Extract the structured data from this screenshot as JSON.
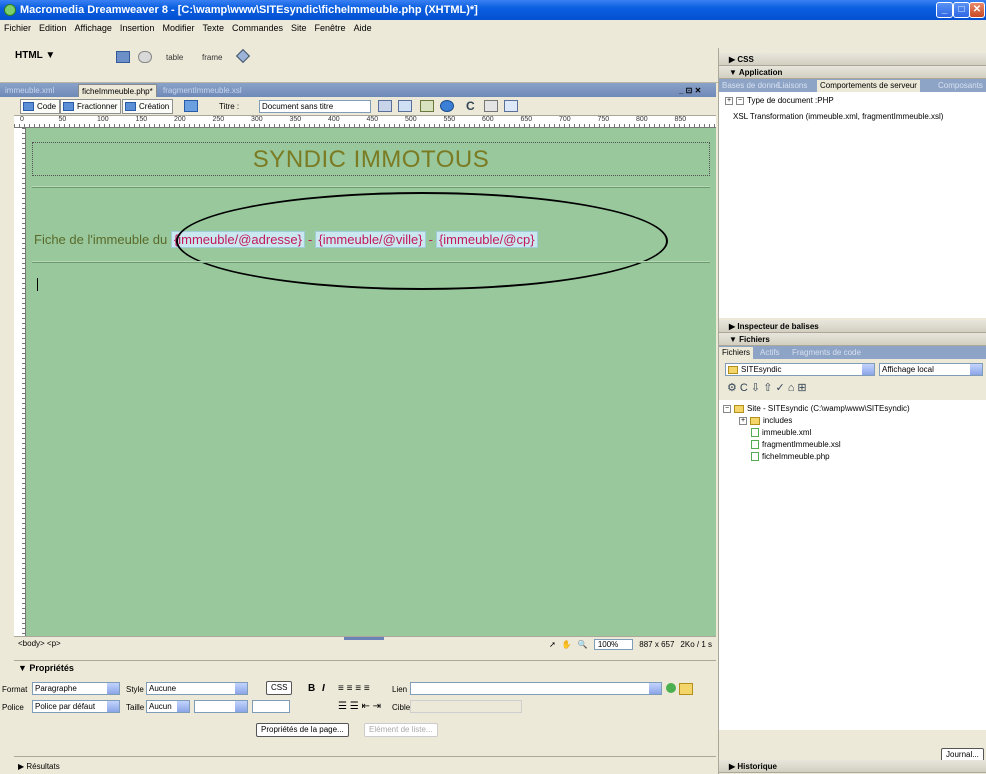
{
  "window": {
    "title": "Macromedia Dreamweaver 8 - [C:\\wamp\\www\\SITEsyndic\\ficheImmeuble.php (XHTML)*]"
  },
  "menu": [
    "Fichier",
    "Edition",
    "Affichage",
    "Insertion",
    "Modifier",
    "Texte",
    "Commandes",
    "Site",
    "Fenêtre",
    "Aide"
  ],
  "insertbar": {
    "category": "HTML ▼",
    "table_label": "table",
    "frame_label": "frame"
  },
  "doc_tabs": [
    "immeuble.xml",
    "ficheImmeuble.php*",
    "fragmentImmeuble.xsl"
  ],
  "doc_toolbar": {
    "code": "Code",
    "split": "Fractionner",
    "design": "Création",
    "title_label": "Titre :",
    "title_value": "Document sans titre"
  },
  "ruler_h_labels": [
    "0",
    "50",
    "100",
    "150",
    "200",
    "250",
    "300",
    "350",
    "400",
    "450",
    "500",
    "550",
    "600",
    "650",
    "700",
    "750",
    "800",
    "850"
  ],
  "canvas": {
    "site_title": "SYNDIC IMMOTOUS",
    "fiche_prefix": "Fiche de l'immeuble du",
    "vars": [
      "{immeuble/@adresse}",
      "{immeuble/@ville}",
      "{immeuble/@cp}"
    ],
    "separator": "-"
  },
  "statusbar": {
    "tag_selector": "<body> <p>",
    "zoom": "100%",
    "size": "887 x 657",
    "weight": "2Ko / 1 s"
  },
  "properties": {
    "header": "▼ Propriétés",
    "format_label": "Format",
    "format_value": "Paragraphe",
    "style_label": "Style",
    "style_value": "Aucune",
    "css_btn": "CSS",
    "link_label": "Lien",
    "font_label": "Police",
    "font_value": "Police par défaut",
    "size_label": "Taille",
    "size_value": "Aucun",
    "target_label": "Cible",
    "page_props_btn": "Propriétés de la page...",
    "list_item_btn": "Elément de liste..."
  },
  "results": "▶ Résultats",
  "right": {
    "css_head": "▶ CSS",
    "app_head": "▼ Application",
    "app_tabs": [
      "Bases de donné",
      "Liaisons",
      "Comportements de serveur",
      "Composants"
    ],
    "doc_type": "Type de document :PHP",
    "xsl_item": "XSL Transformation (immeuble.xml, fragmentImmeuble.xsl)",
    "tag_inspector": "▶ Inspecteur de balises",
    "files_head": "▼ Fichiers",
    "files_tabs": [
      "Fichiers",
      "Actifs",
      "Fragments de code"
    ],
    "site_select": "SITEsyndic",
    "view_select": "Affichage local",
    "tree": {
      "root": "Site - SITEsyndic (C:\\wamp\\www\\SITEsyndic)",
      "items": [
        "includes",
        "immeuble.xml",
        "fragmentImmeuble.xsl",
        "ficheImmeuble.php"
      ]
    },
    "journal_btn": "Journal...",
    "history_head": "▶ Historique"
  }
}
